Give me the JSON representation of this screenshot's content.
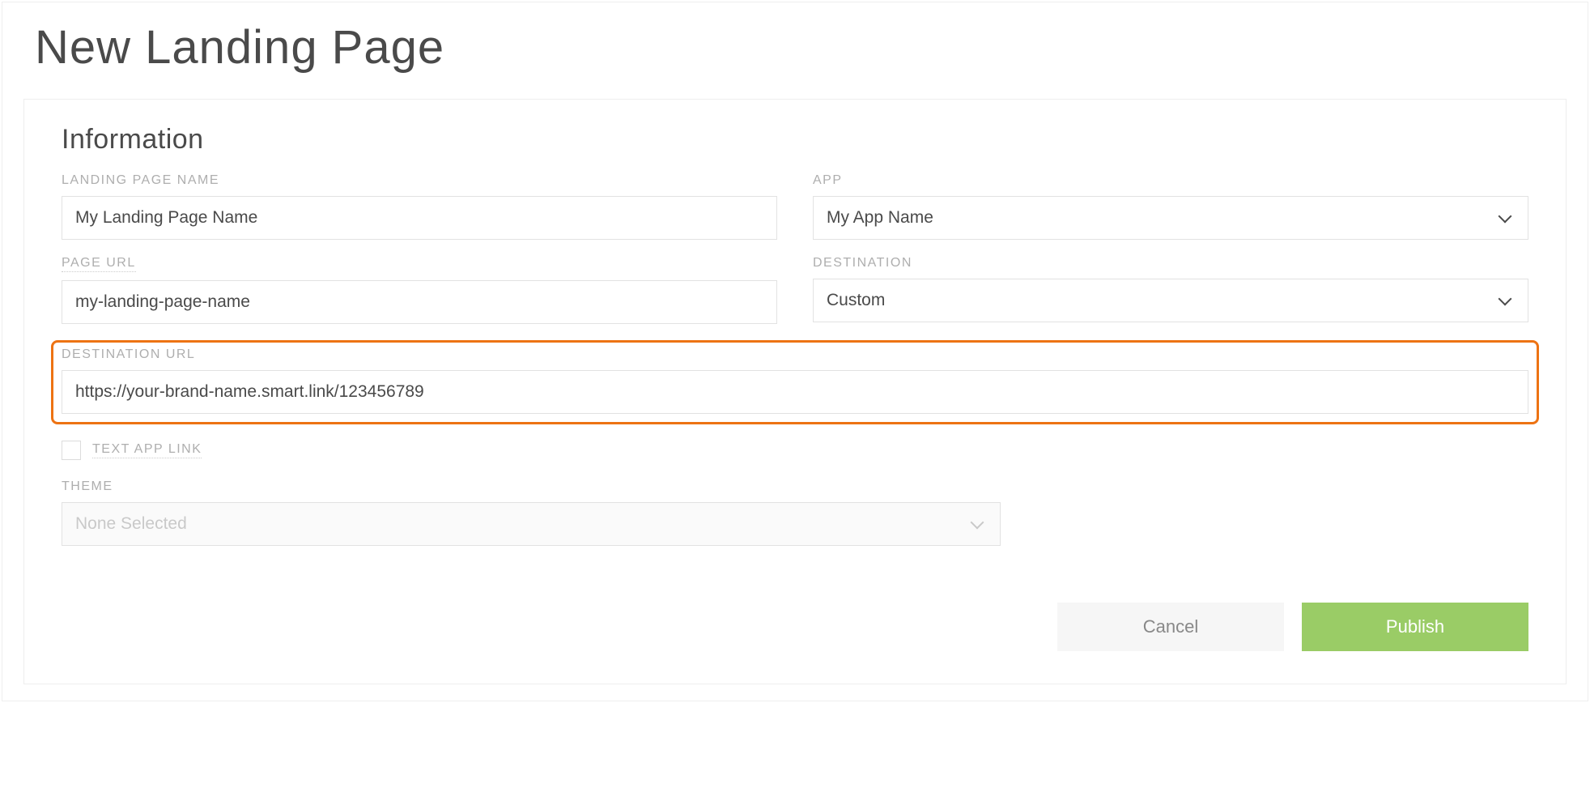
{
  "page_title": "New Landing Page",
  "section_title": "Information",
  "fields": {
    "landing_page_name": {
      "label": "LANDING PAGE NAME",
      "value": "My Landing Page Name"
    },
    "app": {
      "label": "APP",
      "value": "My App Name"
    },
    "page_url": {
      "label": "PAGE URL",
      "value": "my-landing-page-name"
    },
    "destination": {
      "label": "DESTINATION",
      "value": "Custom"
    },
    "destination_url": {
      "label": "DESTINATION URL",
      "value": "https://your-brand-name.smart.link/123456789"
    },
    "text_app_link": {
      "label": "TEXT APP LINK"
    },
    "theme": {
      "label": "THEME",
      "value": "None Selected"
    }
  },
  "actions": {
    "cancel": "Cancel",
    "publish": "Publish"
  }
}
